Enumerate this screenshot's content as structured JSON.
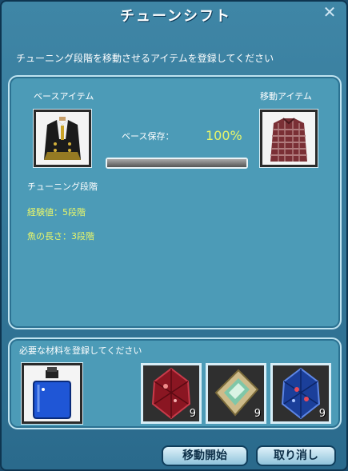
{
  "window": {
    "title": "チューンシフト",
    "close_glyph": "✕",
    "instruction": "チューニング段階を移動させるアイテムを登録してください"
  },
  "base": {
    "label": "ベースアイテム",
    "icon": "jacket-icon"
  },
  "target": {
    "label": "移動アイテム",
    "icon": "sweater-icon"
  },
  "retention": {
    "label": "ベース保存：",
    "value": "100%",
    "bar_fraction": 1.0
  },
  "tuning": {
    "heading": "チューニング段階",
    "lines": [
      "経験値：5段階",
      "魚の長さ：3段階"
    ]
  },
  "materials": {
    "label": "必要な材料を登録してください",
    "main_icon": "moon-potion-icon",
    "items": [
      {
        "icon": "red-gem-icon",
        "count": "9"
      },
      {
        "icon": "green-crystal-icon",
        "count": "9"
      },
      {
        "icon": "blue-gem-icon",
        "count": "9"
      }
    ]
  },
  "buttons": {
    "start": "移動開始",
    "cancel": "取り消し"
  },
  "colors": {
    "window": "#3f86a6",
    "panel": "#4c9bb7",
    "highlight_text": "#e7f56a"
  }
}
